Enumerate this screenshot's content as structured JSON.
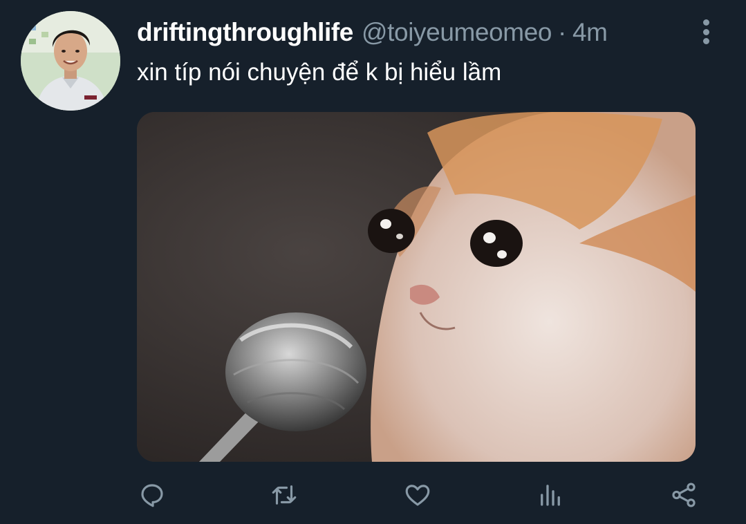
{
  "tweet": {
    "display_name": "driftingthroughlife",
    "handle": "@toiyeumeomeo",
    "separator": "·",
    "time": "4m",
    "text": "xin típ nói chuyện để k bị hiểu lầm"
  },
  "header": {
    "more_icon": "more-vertical-icon"
  },
  "media": {
    "kind": "photo",
    "subject": "crying-cat-with-microphone"
  },
  "actions": [
    {
      "name": "reply",
      "icon": "reply-icon"
    },
    {
      "name": "retweet",
      "icon": "retweet-icon"
    },
    {
      "name": "like",
      "icon": "heart-icon"
    },
    {
      "name": "analytics",
      "icon": "analytics-icon"
    },
    {
      "name": "share",
      "icon": "share-icon"
    }
  ],
  "colors": {
    "background": "#16202b",
    "primary_text": "#ffffff",
    "secondary_text": "#8899a6"
  }
}
